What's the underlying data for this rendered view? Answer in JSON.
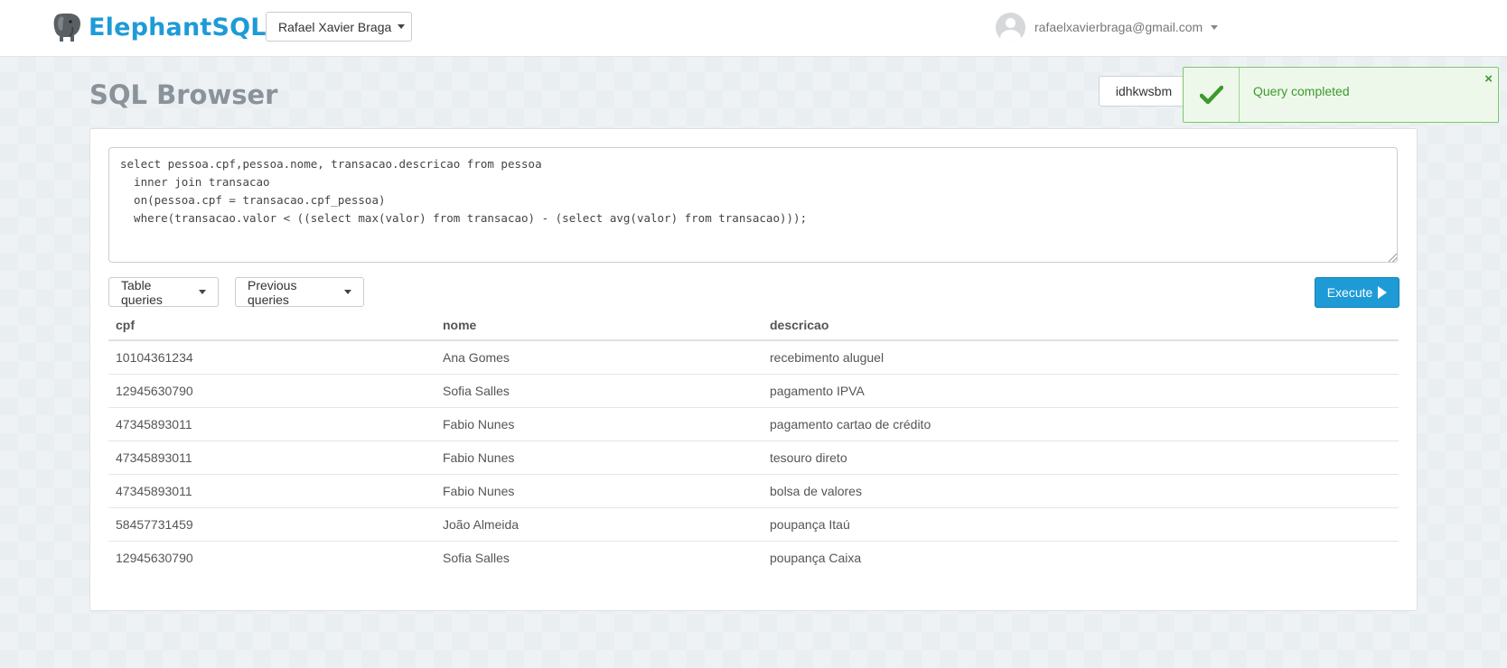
{
  "header": {
    "brand": "ElephantSQL",
    "team_selector": "Rafael Xavier Braga",
    "user_email": "rafaelxavierbraga@gmail.com"
  },
  "page": {
    "title": "SQL Browser",
    "database_name": "idhkwsbm"
  },
  "toast": {
    "message": "Query completed",
    "close_label": "×",
    "color": "#3c9a2e"
  },
  "editor": {
    "query": "select pessoa.cpf,pessoa.nome, transacao.descricao from pessoa\n  inner join transacao\n  on(pessoa.cpf = transacao.cpf_pessoa)\n  where(transacao.valor < ((select max(valor) from transacao) - (select avg(valor) from transacao)));"
  },
  "toolbar": {
    "table_queries_label": "Table queries",
    "previous_queries_label": "Previous queries",
    "execute_label": "Execute"
  },
  "results": {
    "columns": [
      "cpf",
      "nome",
      "descricao"
    ],
    "rows": [
      [
        "10104361234",
        "Ana Gomes",
        "recebimento aluguel"
      ],
      [
        "12945630790",
        "Sofia Salles",
        "pagamento IPVA"
      ],
      [
        "47345893011",
        "Fabio Nunes",
        "pagamento cartao de crédito"
      ],
      [
        "47345893011",
        "Fabio Nunes",
        "tesouro direto"
      ],
      [
        "47345893011",
        "Fabio Nunes",
        "bolsa de valores"
      ],
      [
        "58457731459",
        "João Almeida",
        "poupança Itaú"
      ],
      [
        "12945630790",
        "Sofia Salles",
        "poupança Caixa"
      ]
    ]
  },
  "colors": {
    "brand": "#1e9bd7",
    "success_border": "#7cc86b",
    "success_bg": "#eef8ea"
  }
}
